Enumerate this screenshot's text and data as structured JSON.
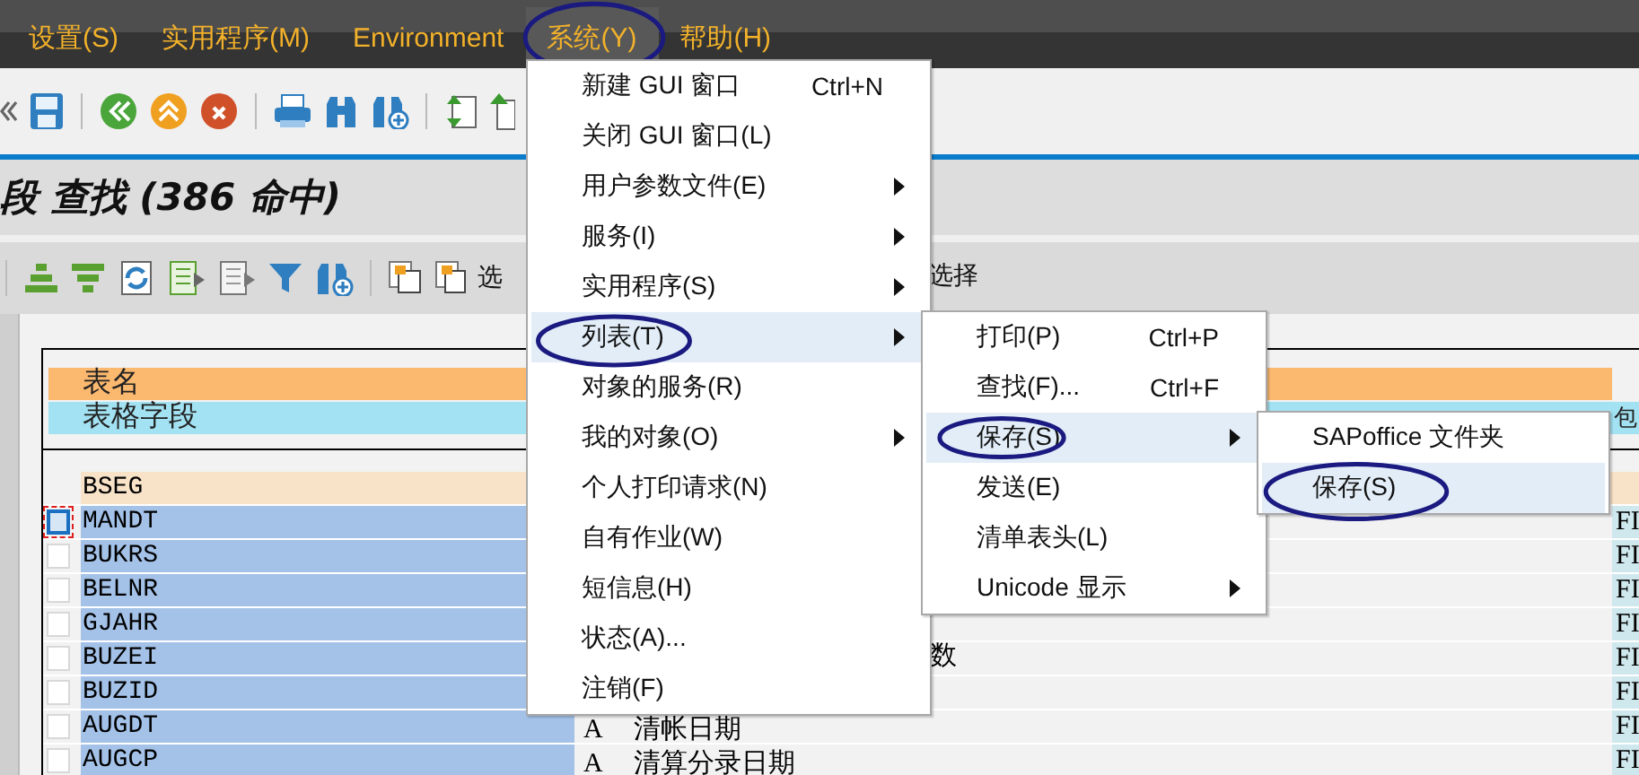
{
  "menu_bar": [
    {
      "label": "设置(S)",
      "selected": false,
      "circled": false
    },
    {
      "label": "实用程序(M)",
      "selected": false,
      "circled": false
    },
    {
      "label": "Environment",
      "selected": false,
      "circled": false
    },
    {
      "label": "系统(Y)",
      "selected": true,
      "circled": true
    },
    {
      "label": "帮助(H)",
      "selected": false,
      "circled": false
    }
  ],
  "title": "段 查找 (386 命中)",
  "application_toolbar": {
    "texts": [
      "选",
      "选择"
    ]
  },
  "table": {
    "header_rows": [
      {
        "kind": "table",
        "label": "表名"
      },
      {
        "kind": "field",
        "label": "表格字段",
        "column_4": "包"
      }
    ],
    "group_row": {
      "name": "BSEG"
    },
    "rows": [
      {
        "name": "MANDT",
        "checked": false,
        "focused": true,
        "column_4": "FI"
      },
      {
        "name": "BUKRS",
        "checked": false,
        "focused": false,
        "column_4": "FI"
      },
      {
        "name": "BELNR",
        "checked": false,
        "focused": false,
        "column_4": "FI"
      },
      {
        "name": "GJAHR",
        "checked": false,
        "focused": false,
        "column_4": "FI"
      },
      {
        "name": "BUZEI",
        "checked": false,
        "focused": false,
        "description": "数",
        "description_partial": true,
        "column_4": "FI"
      },
      {
        "name": "BUZID",
        "checked": false,
        "focused": false,
        "column_4": "FI"
      },
      {
        "name": "AUGDT",
        "checked": false,
        "focused": false,
        "type": "A",
        "description": "清帐日期",
        "column_4": "FI"
      },
      {
        "name": "AUGCP",
        "checked": false,
        "focused": false,
        "type": "A",
        "description": "清算分录日期",
        "column_4": "FI"
      }
    ]
  },
  "menu": {
    "items": [
      {
        "label": "新建 GUI 窗口",
        "shortcut": "Ctrl+N",
        "submenu": false,
        "selected": false,
        "circled": false
      },
      {
        "label": "关闭 GUI 窗口(L)",
        "submenu": false,
        "selected": false,
        "circled": false
      },
      {
        "label": "用户参数文件(E)",
        "submenu": true,
        "selected": false,
        "circled": false
      },
      {
        "label": "服务(I)",
        "submenu": true,
        "selected": false,
        "circled": false
      },
      {
        "label": "实用程序(S)",
        "submenu": true,
        "selected": false,
        "circled": false
      },
      {
        "label": "列表(T)",
        "submenu": true,
        "selected": true,
        "circled": true
      },
      {
        "label": "对象的服务(R)",
        "submenu": false,
        "selected": false,
        "circled": false
      },
      {
        "label": "我的对象(O)",
        "submenu": true,
        "selected": false,
        "circled": false
      },
      {
        "label": "个人打印请求(N)",
        "submenu": false,
        "selected": false,
        "circled": false
      },
      {
        "label": "自有作业(W)",
        "submenu": false,
        "selected": false,
        "circled": false
      },
      {
        "label": "短信息(H)",
        "submenu": false,
        "selected": false,
        "circled": false
      },
      {
        "label": "状态(A)...",
        "submenu": false,
        "selected": false,
        "circled": false
      },
      {
        "label": "注销(F)",
        "submenu": false,
        "selected": false,
        "circled": false
      }
    ]
  },
  "submenu": {
    "items": [
      {
        "label": "打印(P)",
        "shortcut": "Ctrl+P",
        "submenu": false,
        "selected": false,
        "circled": false
      },
      {
        "label": "查找(F)...",
        "shortcut": "Ctrl+F",
        "submenu": false,
        "selected": false,
        "circled": false
      },
      {
        "label": "保存(S)",
        "submenu": true,
        "selected": true,
        "circled": true
      },
      {
        "label": "发送(E)",
        "submenu": false,
        "selected": false,
        "circled": false
      },
      {
        "label": "清单表头(L)",
        "submenu": false,
        "selected": false,
        "circled": false
      },
      {
        "label": "Unicode 显示",
        "submenu": true,
        "selected": false,
        "circled": false
      }
    ]
  },
  "submenu_2": {
    "items": [
      {
        "label": "SAPoffice 文件夹",
        "submenu": false,
        "selected": false,
        "circled": false
      },
      {
        "label": "保存(S)",
        "submenu": false,
        "selected": true,
        "circled": true
      }
    ]
  }
}
